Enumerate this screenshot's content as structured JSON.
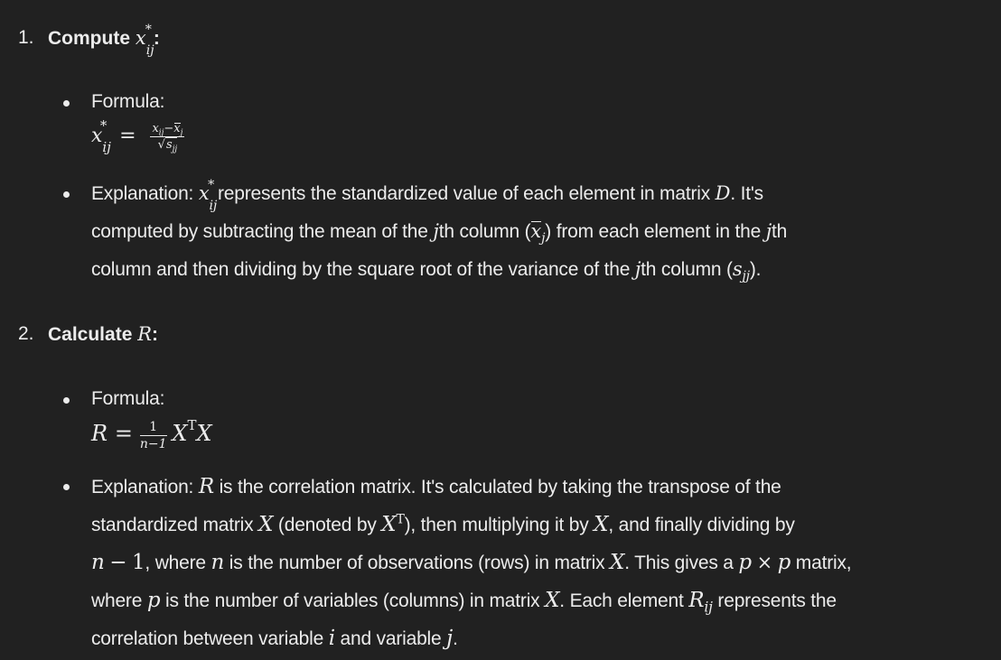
{
  "items": [
    {
      "number": "1.",
      "heading_label": "Compute",
      "heading_math": "x*ij",
      "heading_colon": ":",
      "formula_label": "Formula:",
      "formula": "x*ij = (xij − x̄j) / √sjj",
      "explanation_label": "Explanation:",
      "explanation_lines": [
        "x*ij represents the standardized value of each element in matrix D. It's",
        "computed by subtracting the mean of the jth column (x̄j) from each element in the jth",
        "column and then dividing by the square root of the variance of the jth column (sjj)."
      ]
    },
    {
      "number": "2.",
      "heading_label": "Calculate",
      "heading_math": "R",
      "heading_colon": ":",
      "formula_label": "Formula:",
      "formula": "R = 1/(n−1) XᵀX",
      "explanation_label": "Explanation:",
      "explanation_lines": [
        "R is the correlation matrix. It's calculated by taking the transpose of the",
        "standardized matrix X (denoted by Xᵀ), then multiplying it by X, and finally dividing by",
        "n − 1, where n is the number of observations (rows) in matrix X. This gives a p × p matrix,",
        "where p is the number of variables (columns) in matrix X. Each element Rij represents the",
        "correlation between variable i and variable j."
      ]
    }
  ]
}
